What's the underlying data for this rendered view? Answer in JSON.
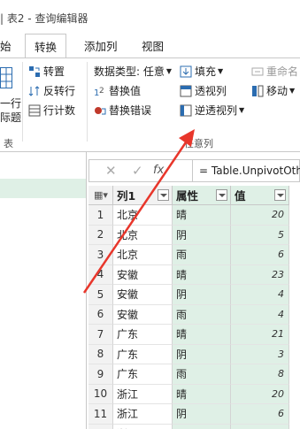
{
  "window": {
    "title": "| 表2 - 查询编辑器"
  },
  "tabs": [
    {
      "label": "始"
    },
    {
      "label": "转换"
    },
    {
      "label": "添加列"
    },
    {
      "label": "视图"
    }
  ],
  "ribbon": {
    "left_fragments": {
      "row1": "一行",
      "row2": "际题",
      "group": "表"
    },
    "transpose": "转置",
    "reverse_rows": "反转行",
    "count_rows": "行计数",
    "data_type": "数据类型: 任意",
    "fill": "填充",
    "rename": "重命名",
    "replace_values": "替换值",
    "pivot_column": "透视列",
    "move": "移动",
    "replace_errors": "替换错误",
    "unpivot_columns": "逆透视列",
    "group_label": "任意列"
  },
  "formula_bar": {
    "cancel": "✕",
    "confirm": "✓",
    "fx": "fx",
    "formula": "= Table.UnpivotOth"
  },
  "table": {
    "columns": [
      {
        "name": "列1",
        "color": "#f2f2f2"
      },
      {
        "name": "属性",
        "color": "#dff0e6"
      },
      {
        "name": "值",
        "color": "#dff0e6"
      }
    ],
    "rows": [
      {
        "idx": "1",
        "c1": "北京",
        "c2": "晴",
        "c3": "20"
      },
      {
        "idx": "2",
        "c1": "北京",
        "c2": "阴",
        "c3": "5"
      },
      {
        "idx": "3",
        "c1": "北京",
        "c2": "雨",
        "c3": "6"
      },
      {
        "idx": "4",
        "c1": "安徽",
        "c2": "晴",
        "c3": "23"
      },
      {
        "idx": "5",
        "c1": "安徽",
        "c2": "阴",
        "c3": "4"
      },
      {
        "idx": "6",
        "c1": "安徽",
        "c2": "雨",
        "c3": "4"
      },
      {
        "idx": "7",
        "c1": "广东",
        "c2": "晴",
        "c3": "21"
      },
      {
        "idx": "8",
        "c1": "广东",
        "c2": "阴",
        "c3": "3"
      },
      {
        "idx": "9",
        "c1": "广东",
        "c2": "雨",
        "c3": "8"
      },
      {
        "idx": "10",
        "c1": "浙江",
        "c2": "晴",
        "c3": "20"
      },
      {
        "idx": "11",
        "c1": "浙江",
        "c2": "阴",
        "c3": "6"
      },
      {
        "idx": "12",
        "c1": "浙江",
        "c2": "雨",
        "c3": "5"
      }
    ]
  },
  "colors": {
    "accent_green": "#dff0e6",
    "arrow_red": "#e8362b",
    "icon_blue": "#2b6cb0"
  }
}
